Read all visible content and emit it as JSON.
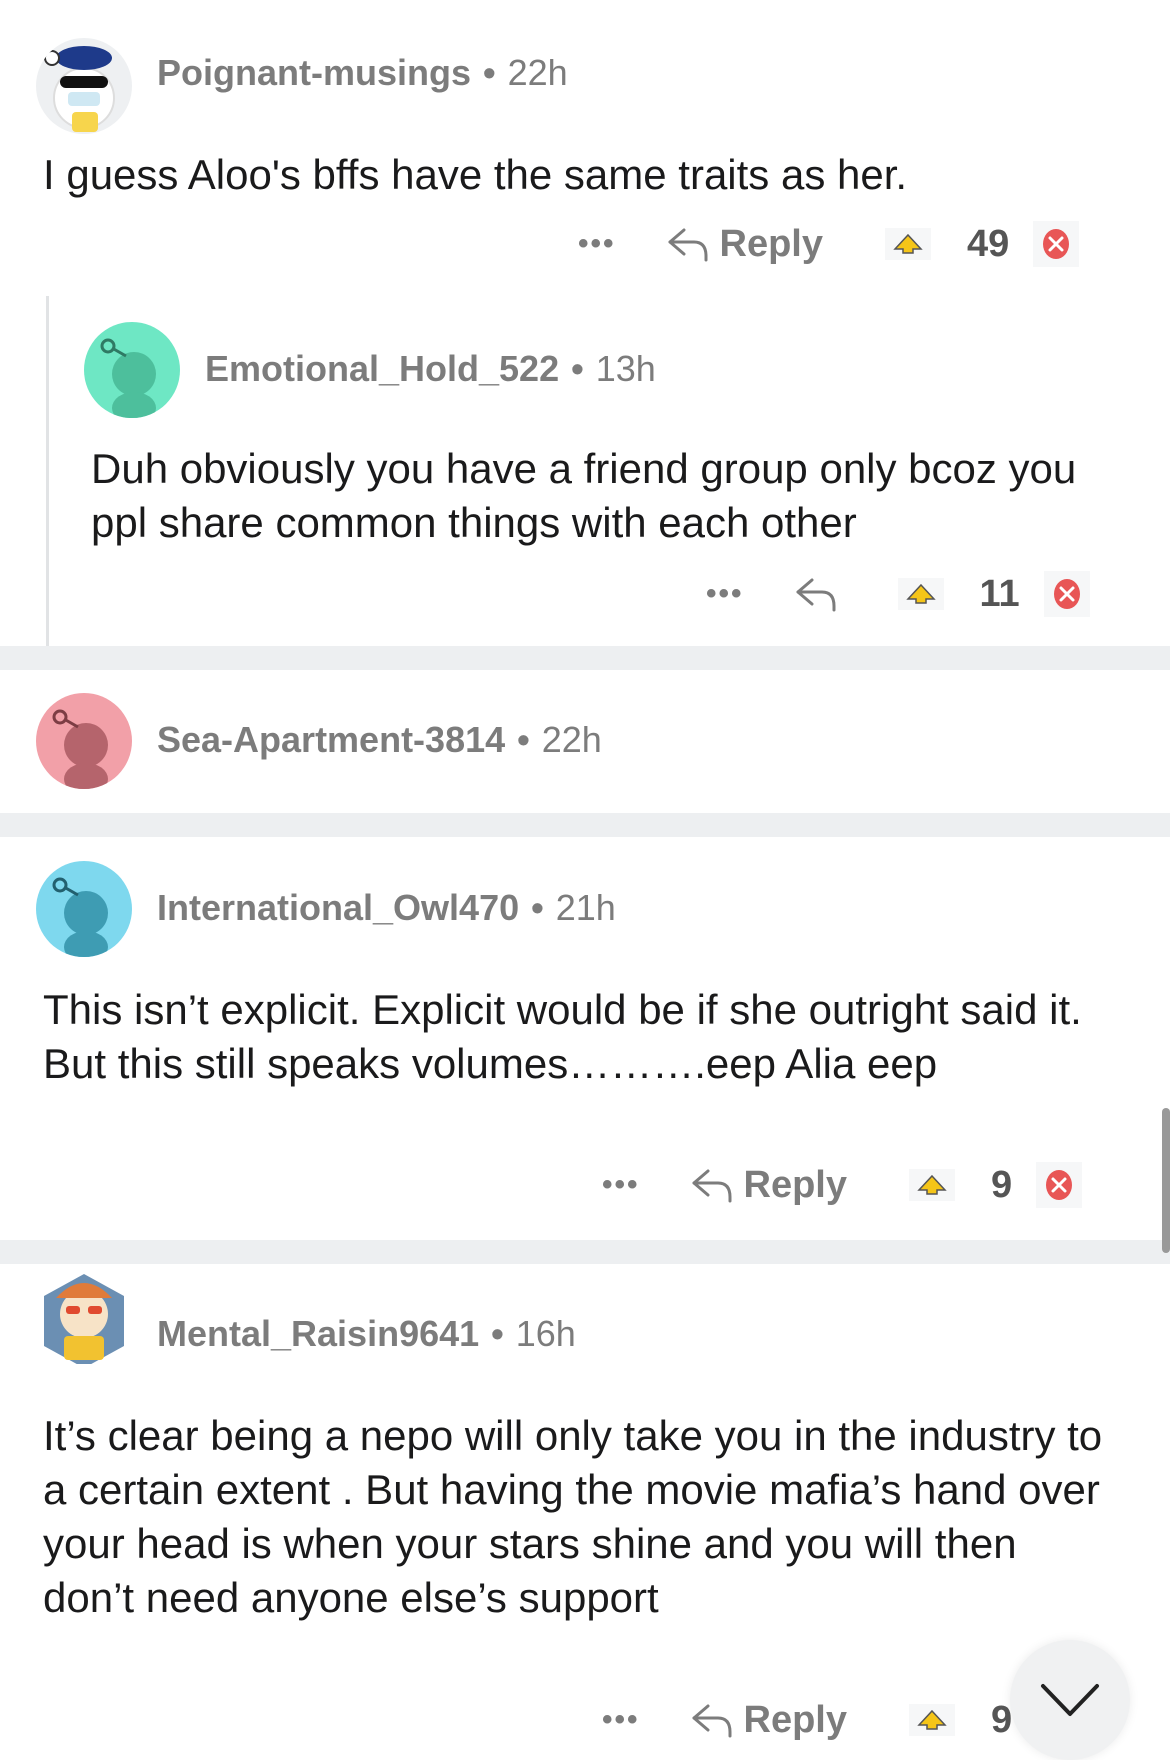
{
  "comments": [
    {
      "username": "Poignant-musings",
      "time": "22h",
      "body": "I guess Aloo's bffs have the same traits as her.",
      "reply_label": "Reply",
      "score": "49"
    },
    {
      "username": "Emotional_Hold_522",
      "time": "13h",
      "body": "Duh obviously you have a friend group only bcoz you ppl share common things with each other",
      "score": "11"
    },
    {
      "username": "Sea-Apartment-3814",
      "time": "22h"
    },
    {
      "username": "International_Owl470",
      "time": "21h",
      "body": "This isn’t explicit. Explicit would be if she outright said it. But this still speaks volumes……….eep Alia eep",
      "reply_label": "Reply",
      "score": "9"
    },
    {
      "username": "Mental_Raisin9641",
      "time": "16h",
      "body": "It’s clear being a nepo will only take you in the industry to a certain extent . But having the movie mafia’s hand over your head is when your stars shine and you will then don’t need anyone else’s support",
      "reply_label": "Reply",
      "score": "9"
    }
  ],
  "more_glyph": "•••",
  "separator_glyph": "•",
  "colors": {
    "avatar_teal": "#6ee7c4",
    "avatar_pink": "#f2a0a8",
    "avatar_cyan": "#7ed8ee",
    "award_yellow": "#f5c518",
    "remove_red": "#e85656"
  }
}
